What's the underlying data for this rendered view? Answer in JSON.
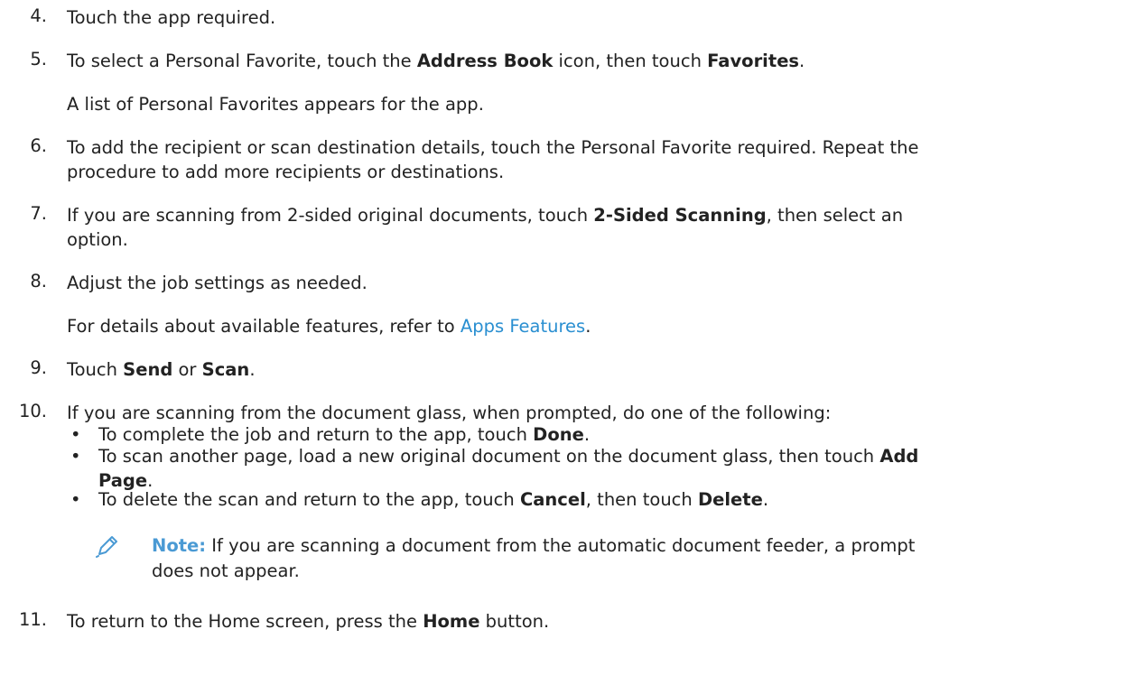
{
  "steps": {
    "s4": {
      "num": "4.",
      "text": "Touch the app required."
    },
    "s5": {
      "num": "5.",
      "t1": "To select a Personal Favorite, touch the ",
      "b1": "Address Book",
      "t2": " icon, then touch ",
      "b2": "Favorites",
      "t3": "."
    },
    "s5_para": "A list of Personal Favorites appears for the app.",
    "s6": {
      "num": "6.",
      "line1": "To add the recipient or scan destination details, touch the Personal Favorite required. Repeat the",
      "line2": "procedure to add more recipients or destinations."
    },
    "s7": {
      "num": "7.",
      "t1": "If you are scanning from 2-sided original documents, touch ",
      "b1": "2-Sided Scanning",
      "t2": ", then select an",
      "line2": "option."
    },
    "s8": {
      "num": "8.",
      "text": "Adjust the job settings as needed."
    },
    "s8_para": {
      "t1": "For details about available features, refer to ",
      "link": "Apps Features",
      "t2": "."
    },
    "s9": {
      "num": "9.",
      "t1": "Touch ",
      "b1": "Send",
      "t2": " or ",
      "b2": "Scan",
      "t3": "."
    },
    "s10": {
      "num": "10.",
      "text": "If you are scanning from the document glass, when prompted, do one of the following:"
    },
    "bullets": {
      "b1": {
        "t1": "To complete the job and return to the app, touch ",
        "b1": "Done",
        "t2": "."
      },
      "b2": {
        "t1": "To scan another page, load a new original document on the document glass, then touch ",
        "b1": "Add",
        "b2": "Page",
        "t2": "."
      },
      "b3": {
        "t1": "To delete the scan and return to the app, touch ",
        "b1": "Cancel",
        "t2": ", then touch ",
        "b2": "Delete",
        "t3": "."
      }
    },
    "note": {
      "label": "Note:",
      "line1": " If you are scanning a document from the automatic document feeder, a prompt",
      "line2": "does not appear."
    },
    "s11": {
      "num": "11.",
      "t1": "To return to the Home screen, press the ",
      "b1": "Home",
      "t2": " button."
    }
  },
  "icons": {
    "note": "pencil-icon"
  },
  "colors": {
    "text": "#222222",
    "link": "#2a8fd1",
    "note_label": "#4a9ad4"
  }
}
